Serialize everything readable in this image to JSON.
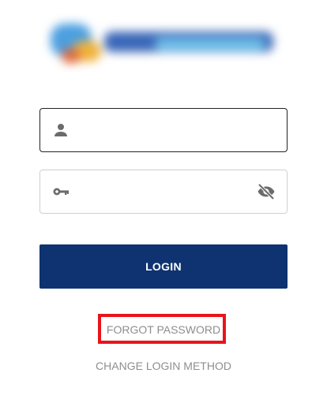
{
  "icons": {
    "user": "person-icon",
    "password": "key-icon",
    "visibility": "eye-off-icon"
  },
  "username": {
    "value": "",
    "placeholder": ""
  },
  "password": {
    "value": "",
    "placeholder": ""
  },
  "login": {
    "label": "LOGIN"
  },
  "links": {
    "forgot_password": "FORGOT PASSWORD",
    "change_login_method": "CHANGE LOGIN METHOD"
  },
  "colors": {
    "primary": "#0e3370",
    "link": "#8e8e8e",
    "highlight": "#e8141b"
  }
}
